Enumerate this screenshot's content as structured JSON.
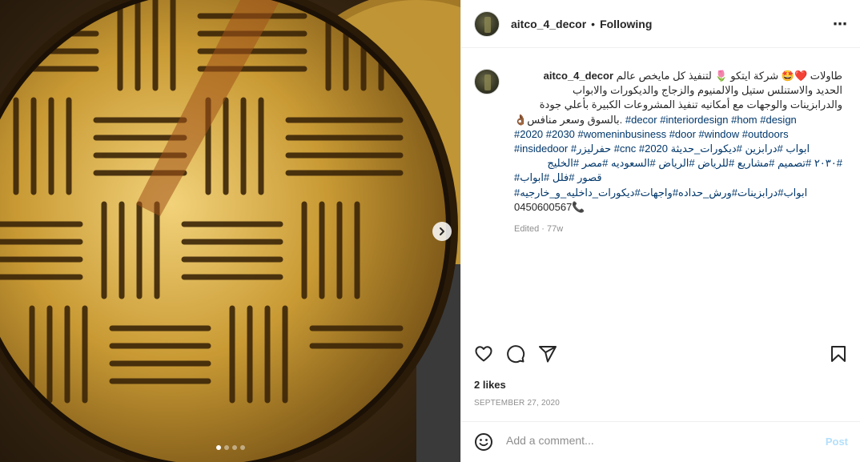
{
  "post": {
    "username": "aitco_4_decor",
    "separator": "•",
    "follow_status": "Following",
    "more_icon": "⋯",
    "caption": {
      "username": "aitco_4_decor",
      "line1": "طاولات ❤️🤩 شركة ايتكو 🌷 لتنفيذ كل مايخص عالم",
      "line2": "الحديد والاستنلس ستيل والالمنيوم والزجاج والديكورات والابواب",
      "line3": "والدرابزينات والوجهات مع أمكانيه تنفيذ المشروعات الكبيرة بأعلي جودة",
      "line4_text": "👌🏾بالسوق وسعر منافس.",
      "line4_tags": "#decor #interiordesign #hom #design",
      "line5": "#2020 #2030 #womeninbusiness #door #window #outdoors",
      "line6": "#insidedoor #حفرليزر #cnc #2020 ابواب #درابزين #ديكورات_حديثة",
      "line7": "#٢٠٣٠ #تصميم #مشاريع #للرياض #الرياض #السعوديه #مصر #الخليج",
      "line8": "#قصور #فلل #ابواب",
      "line9": "#ابواب#درابزينات#ورش_حداده#واجهات#ديكورات_داخليه_و_خارجيه",
      "line10": "0450600567📞",
      "edited": "Edited · 77w"
    },
    "likes": "2 likes",
    "date": "SEPTEMBER 27, 2020",
    "comment_placeholder": "Add a comment...",
    "post_label": "Post",
    "carousel": {
      "total": 4,
      "active": 1
    }
  },
  "colors": {
    "tag": "#00376b",
    "post_button_disabled": "#b2dffc",
    "muted": "#8e8e8e"
  }
}
